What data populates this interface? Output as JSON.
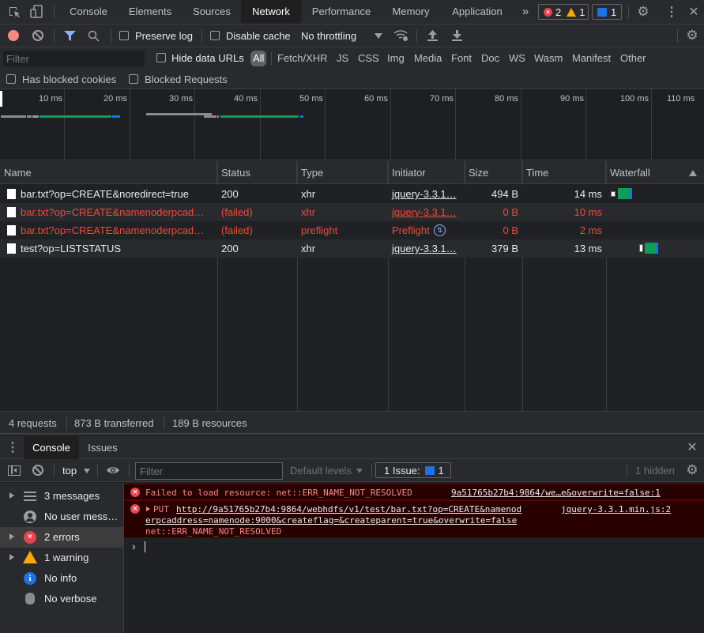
{
  "tabs": {
    "items": [
      {
        "label": "Console"
      },
      {
        "label": "Elements"
      },
      {
        "label": "Sources"
      },
      {
        "label": "Network",
        "active": true
      },
      {
        "label": "Performance"
      },
      {
        "label": "Memory"
      },
      {
        "label": "Application"
      }
    ],
    "more_icon": "»",
    "error_count": "2",
    "warning_count": "1",
    "issue_count": "1"
  },
  "toolbar": {
    "preserve_log": "Preserve log",
    "disable_cache": "Disable cache",
    "throttling": "No throttling"
  },
  "filterbar": {
    "filter_placeholder": "Filter",
    "hide_data_urls": "Hide data URLs",
    "types": [
      "All",
      "Fetch/XHR",
      "JS",
      "CSS",
      "Img",
      "Media",
      "Font",
      "Doc",
      "WS",
      "Wasm",
      "Manifest",
      "Other"
    ],
    "has_blocked_cookies": "Has blocked cookies",
    "blocked_requests": "Blocked Requests"
  },
  "overview": {
    "ticks": [
      "10 ms",
      "20 ms",
      "30 ms",
      "40 ms",
      "50 ms",
      "60 ms",
      "70 ms",
      "80 ms",
      "90 ms",
      "100 ms",
      "110 ms"
    ]
  },
  "table": {
    "columns": [
      "Name",
      "Status",
      "Type",
      "Initiator",
      "Size",
      "Time",
      "Waterfall"
    ],
    "rows": [
      {
        "name": "bar.txt?op=CREATE&noredirect=true",
        "status": "200",
        "type": "xhr",
        "initiator": "jquery-3.3.1…",
        "size": "494 B",
        "time": "14 ms",
        "failed": false
      },
      {
        "name": "bar.txt?op=CREATE&namenoderpcad…",
        "status": "(failed)",
        "type": "xhr",
        "initiator": "jquery-3.3.1…",
        "size": "0 B",
        "time": "10 ms",
        "failed": true
      },
      {
        "name": "bar.txt?op=CREATE&namenoderpcad…",
        "status": "(failed)",
        "type": "preflight",
        "initiator": "Preflight",
        "size": "0 B",
        "time": "2 ms",
        "failed": true
      },
      {
        "name": "test?op=LISTSTATUS",
        "status": "200",
        "type": "xhr",
        "initiator": "jquery-3.3.1…",
        "size": "379 B",
        "time": "13 ms",
        "failed": false
      }
    ]
  },
  "statusbar": {
    "requests": "4 requests",
    "transferred": "873 B transferred",
    "resources": "189 B resources"
  },
  "drawer": {
    "tabs": [
      "Console",
      "Issues"
    ]
  },
  "console_toolbar": {
    "context": "top",
    "filter_placeholder": "Filter",
    "levels": "Default levels",
    "issues_label": "1 Issue:",
    "issues_count": "1",
    "hidden": "1 hidden"
  },
  "sidebar": {
    "items": [
      {
        "label": "3 messages"
      },
      {
        "label": "No user mess…"
      },
      {
        "label": "2 errors"
      },
      {
        "label": "1 warning"
      },
      {
        "label": "No info"
      },
      {
        "label": "No verbose"
      }
    ]
  },
  "console": {
    "messages": [
      {
        "text": "Failed to load resource: net::ERR_NAME_NOT_RESOLVED",
        "source": "9a51765b27b4:9864/we…e&overwrite=false:1"
      },
      {
        "method": "PUT",
        "url_line1": "http://9a51765b27b4:9864/webhdfs/v1/test/bar.txt?op=CREATE&namenod",
        "url_line2": "erpcaddress=namenode:9000&createflag=&createparent=true&overwrite=false",
        "error": "net::ERR_NAME_NOT_RESOLVED",
        "source": "jquery-3.3.1.min.js:2"
      }
    ],
    "prompt": "›"
  }
}
